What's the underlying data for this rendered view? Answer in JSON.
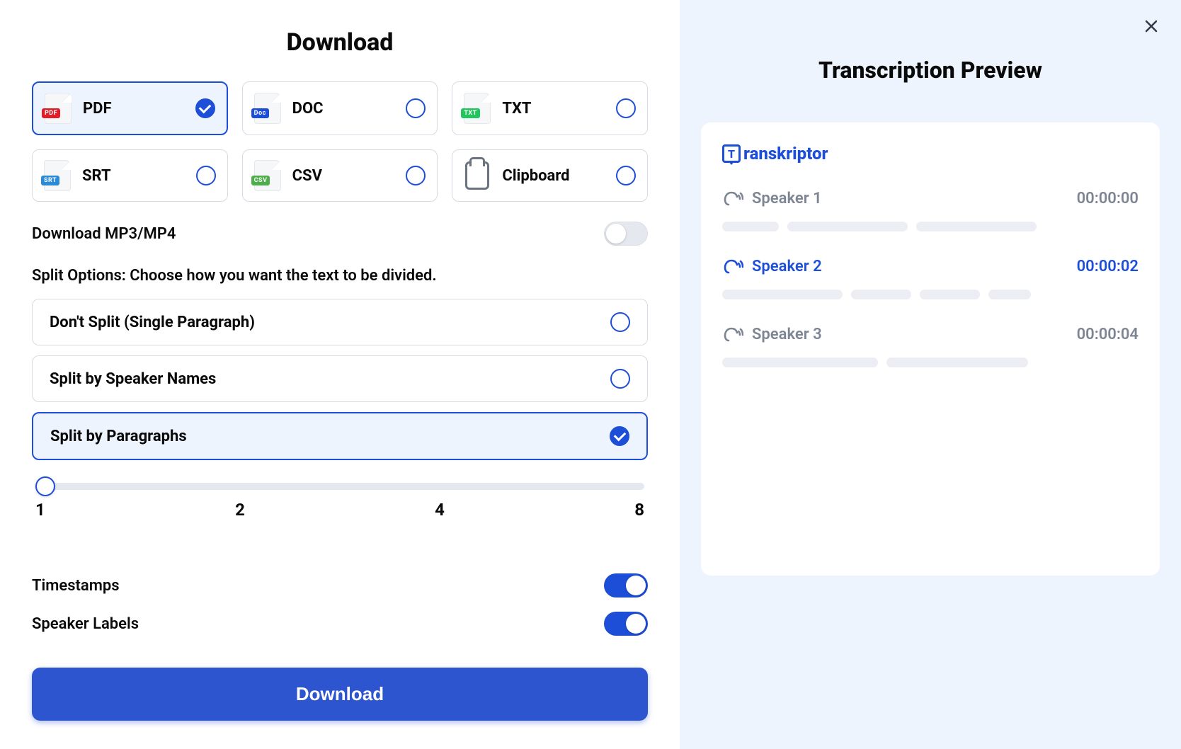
{
  "left": {
    "title": "Download",
    "formats": [
      {
        "id": "pdf",
        "label": "PDF",
        "selected": true,
        "badge": "PDF",
        "badgeClass": "badge-red"
      },
      {
        "id": "doc",
        "label": "DOC",
        "selected": false,
        "badge": "Doc",
        "badgeClass": "badge-blue"
      },
      {
        "id": "txt",
        "label": "TXT",
        "selected": false,
        "badge": "TXT",
        "badgeClass": "badge-green"
      },
      {
        "id": "srt",
        "label": "SRT",
        "selected": false,
        "badge": "SRT",
        "badgeClass": "badge-teal"
      },
      {
        "id": "csv",
        "label": "CSV",
        "selected": false,
        "badge": "CSV",
        "badgeClass": "badge-lime"
      },
      {
        "id": "clipboard",
        "label": "Clipboard",
        "selected": false,
        "badge": "",
        "badgeClass": ""
      }
    ],
    "download_media_label": "Download MP3/MP4",
    "download_media_on": false,
    "split_section_label": "Split Options: Choose how you want the text to be divided.",
    "split_options": [
      {
        "id": "none",
        "label": "Don't Split (Single Paragraph)",
        "selected": false
      },
      {
        "id": "speaker",
        "label": "Split by Speaker Names",
        "selected": false
      },
      {
        "id": "paragraphs",
        "label": "Split by Paragraphs",
        "selected": true
      }
    ],
    "slider": {
      "value": 1,
      "marks": [
        "1",
        "2",
        "4",
        "8"
      ],
      "min": 1,
      "max": 8
    },
    "timestamps_label": "Timestamps",
    "timestamps_on": true,
    "speaker_labels_label": "Speaker Labels",
    "speaker_labels_on": true,
    "download_button": "Download"
  },
  "right": {
    "title": "Transcription Preview",
    "brand": "ranskriptor",
    "brand_letter": "T",
    "speakers": [
      {
        "name": "Speaker 1",
        "time": "00:00:00",
        "highlight": false,
        "bars": [
          80,
          170,
          170
        ]
      },
      {
        "name": "Speaker 2",
        "time": "00:00:02",
        "highlight": true,
        "bars": [
          170,
          85,
          85,
          60
        ]
      },
      {
        "name": "Speaker 3",
        "time": "00:00:04",
        "highlight": false,
        "bars": [
          220,
          200
        ]
      }
    ]
  }
}
